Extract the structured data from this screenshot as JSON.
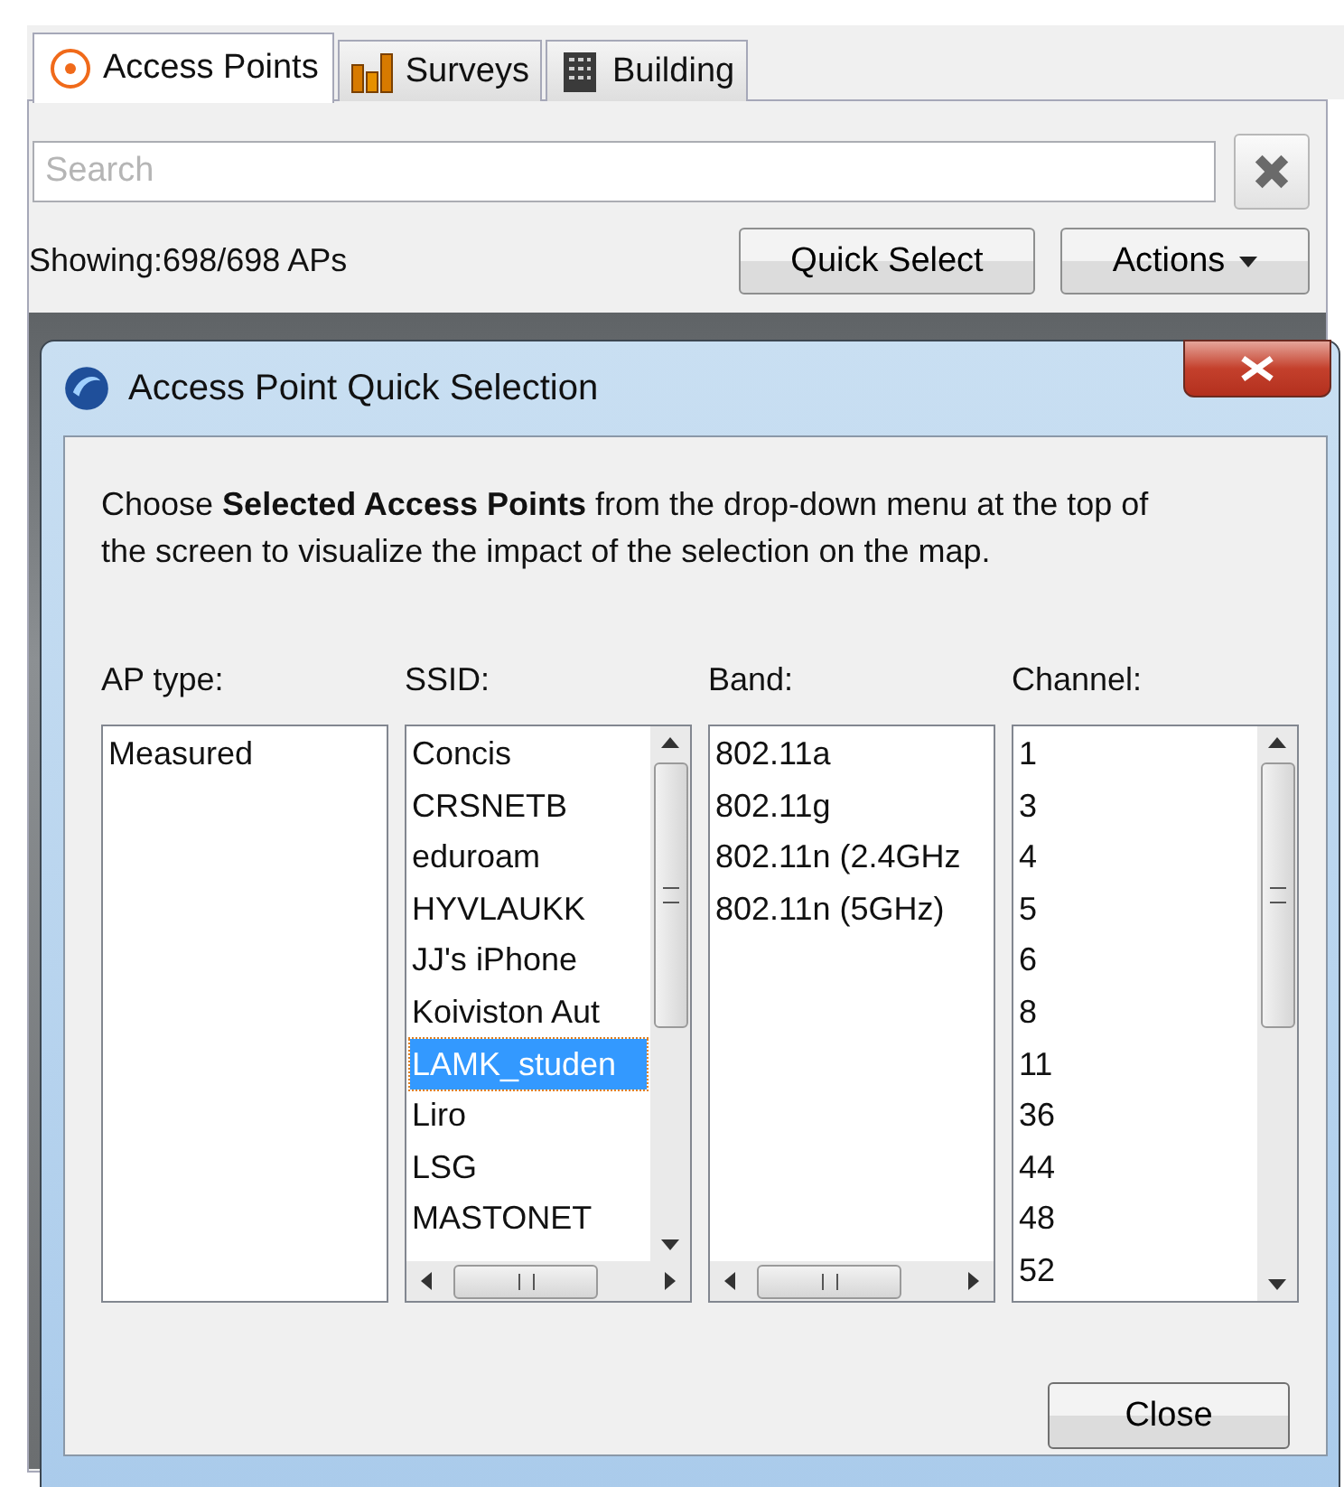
{
  "tabs": [
    {
      "label": "Access Points",
      "selected": true
    },
    {
      "label": "Surveys",
      "selected": false
    },
    {
      "label": "Building",
      "selected": false
    }
  ],
  "search": {
    "placeholder": "Search"
  },
  "status": "Showing:698/698 APs",
  "buttons": [
    {
      "label": "Quick Select",
      "kind": "plain"
    },
    {
      "label": "Actions",
      "kind": "menu"
    }
  ],
  "dialog": {
    "title": "Access Point Quick Selection",
    "intro": "Choose **Selected Access Points** from the drop-down menu at the top of the screen to visualize the impact of the selection on the map.",
    "lists": [
      {
        "label": "AP type:",
        "items": [
          {
            "text": "Measured",
            "selected": false
          }
        ]
      },
      {
        "label": "SSID:",
        "items": [
          {
            "text": "Concis",
            "selected": false
          },
          {
            "text": "CRSNETB",
            "selected": false
          },
          {
            "text": "eduroam",
            "selected": false
          },
          {
            "text": "HYVLAUKK",
            "selected": false
          },
          {
            "text": "JJ's iPhone",
            "selected": false
          },
          {
            "text": "Koiviston Aut",
            "selected": false
          },
          {
            "text": "LAMK_studen",
            "selected": true
          },
          {
            "text": "Liro",
            "selected": false
          },
          {
            "text": "LSG",
            "selected": false
          },
          {
            "text": "MASTONET",
            "selected": false
          }
        ]
      },
      {
        "label": "Band:",
        "items": [
          {
            "text": "802.11a",
            "selected": false
          },
          {
            "text": "802.11g",
            "selected": false
          },
          {
            "text": "802.11n (2.4GHz",
            "selected": false
          },
          {
            "text": "802.11n (5GHz)",
            "selected": false
          }
        ]
      },
      {
        "label": "Channel:",
        "items": [
          {
            "text": "1",
            "selected": false
          },
          {
            "text": "3",
            "selected": false
          },
          {
            "text": "4",
            "selected": false
          },
          {
            "text": "5",
            "selected": false
          },
          {
            "text": "6",
            "selected": false
          },
          {
            "text": "8",
            "selected": false
          },
          {
            "text": "11",
            "selected": false
          },
          {
            "text": "36",
            "selected": false
          },
          {
            "text": "44",
            "selected": false
          },
          {
            "text": "48",
            "selected": false
          },
          {
            "text": "52",
            "selected": false
          }
        ]
      }
    ],
    "close_button": "Close"
  }
}
